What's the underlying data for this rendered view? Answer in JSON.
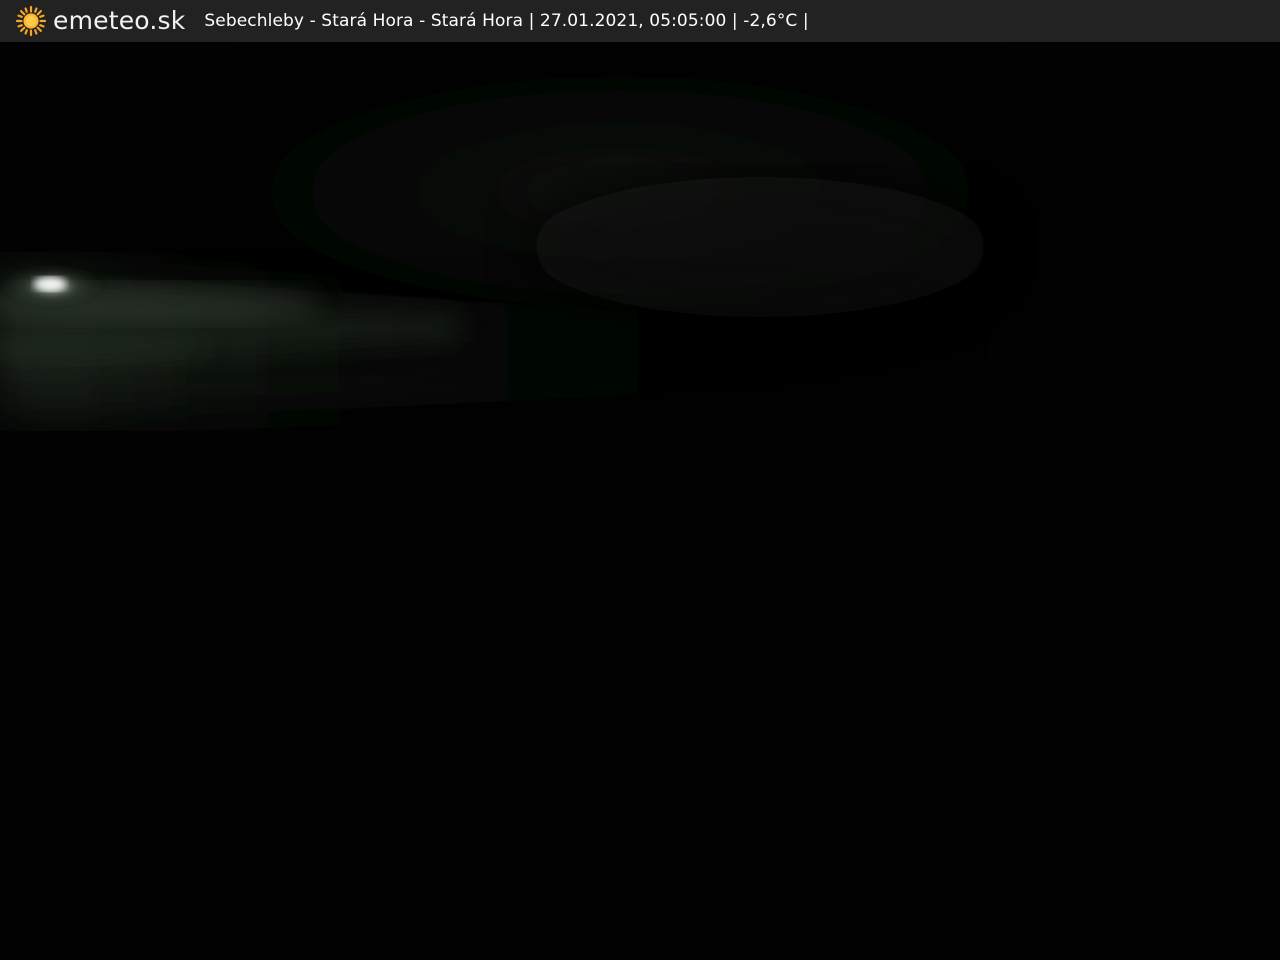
{
  "header": {
    "logo_icon": "sun-icon",
    "brand": "emeteo.sk",
    "caption": "Sebechleby - Stará Hora - Stará Hora | 27.01.2021, 05:05:00 | -2,6°C |"
  },
  "colors": {
    "bar_background": "#222222",
    "brand_text": "#f2f2f2",
    "sun_icon": "#f5a623",
    "scene_background": "#010201"
  }
}
